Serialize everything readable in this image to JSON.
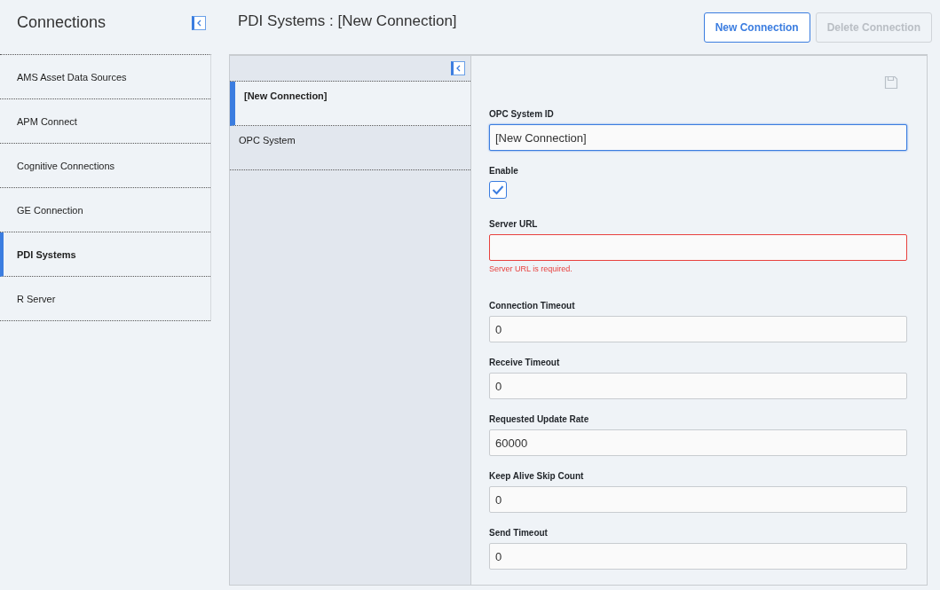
{
  "sidebar": {
    "title": "Connections",
    "items": [
      {
        "label": "AMS Asset Data Sources",
        "selected": false
      },
      {
        "label": "APM Connect",
        "selected": false
      },
      {
        "label": "Cognitive Connections",
        "selected": false
      },
      {
        "label": "GE Connection",
        "selected": false
      },
      {
        "label": "PDI Systems",
        "selected": true
      },
      {
        "label": "R Server",
        "selected": false
      }
    ]
  },
  "header": {
    "title": "PDI Systems : [New Connection]",
    "buttons": [
      {
        "label": "New Connection",
        "disabled": false
      },
      {
        "label": "Delete Connection",
        "disabled": true
      }
    ]
  },
  "records": [
    {
      "label": "[New Connection]",
      "selected": true
    },
    {
      "label": "OPC System",
      "selected": false
    }
  ],
  "form": {
    "fields": [
      {
        "kind": "text",
        "label": "OPC System ID",
        "value": "[New Connection]",
        "focused": true
      },
      {
        "kind": "checkbox",
        "label": "Enable",
        "checked": true
      },
      {
        "kind": "text",
        "label": "Server URL",
        "focused": false,
        "error": "Server URL is required."
      },
      {
        "kind": "text",
        "label": "Connection Timeout",
        "value": "0",
        "focused": false
      },
      {
        "kind": "text",
        "label": "Receive Timeout",
        "value": "0",
        "focused": false
      },
      {
        "kind": "text",
        "label": "Requested Update Rate",
        "value": "60000",
        "focused": false
      },
      {
        "kind": "text",
        "label": "Keep Alive Skip Count",
        "value": "0",
        "focused": false
      },
      {
        "kind": "text",
        "label": "Send Timeout",
        "value": "0",
        "focused": false
      }
    ]
  }
}
